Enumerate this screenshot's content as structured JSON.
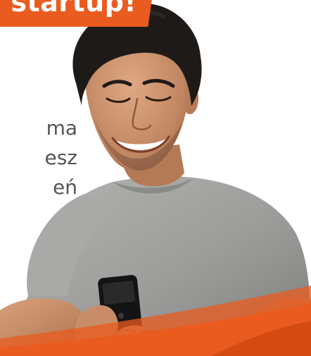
{
  "header": {
    "tag_text": "startup!"
  },
  "body_copy": {
    "lines": [
      "ma",
      "esz",
      "eń"
    ]
  },
  "colors": {
    "accent": "#ea5b1f",
    "shirt": "#9a9a98",
    "skin": "#c48a64",
    "hair": "#1e1a18",
    "text": "#555555"
  }
}
